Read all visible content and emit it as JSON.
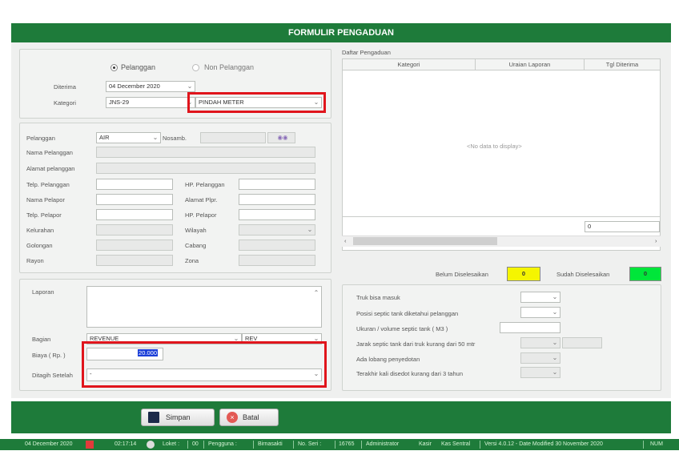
{
  "title": "FORMULIR PENGADUAN",
  "customer_type": {
    "option1": "Pelanggan",
    "option2": "Non Pelanggan",
    "selected": "Pelanggan"
  },
  "form": {
    "diterima_label": "Diterima",
    "diterima_value": "04 December 2020",
    "kategori_label": "Kategori",
    "kategori_code": "JNS-29",
    "kategori_name": "PINDAH METER"
  },
  "pelanggan_section": {
    "pelanggan_label": "Pelanggan",
    "pelanggan_value": "AIR",
    "nosamb_label": "Nosamb.",
    "nama_pelanggan_label": "Nama Pelanggan",
    "alamat_pelanggan_label": "Alamat pelanggan",
    "telp_pelanggan_label": "Telp. Pelanggan",
    "hp_pelanggan_label": "HP. Pelanggan",
    "nama_pelapor_label": "Nama Pelapor",
    "alamat_plpr_label": "Alamat Plpr.",
    "telp_pelapor_label": "Telp. Pelapor",
    "hp_pelapor_label": "HP. Pelapor",
    "kelurahan_label": "Kelurahan",
    "wilayah_label": "Wilayah",
    "golongan_label": "Golongan",
    "cabang_label": "Cabang",
    "rayon_label": "Rayon",
    "zona_label": "Zona"
  },
  "laporan_section": {
    "laporan_label": "Laporan",
    "bagian_label": "Bagian",
    "bagian_value": "REVENUE",
    "bagian_code": "REV",
    "biaya_label": "Biaya ( Rp. )",
    "biaya_value": "20.000",
    "ditagih_label": "Ditagih Setelah",
    "ditagih_value": "-"
  },
  "daftar": {
    "title": "Daftar Pengaduan",
    "columns": [
      "Kategori",
      "Uraian Laporan",
      "Tgl Diterima"
    ],
    "empty_text": "<No data to display>",
    "footer_value": "0"
  },
  "summary": {
    "belum_label": "Belum Diselesaikan",
    "belum_value": "0",
    "belum_color": "#f5f500",
    "sudah_label": "Sudah Diselesaikan",
    "sudah_value": "0",
    "sudah_color": "#00e63a"
  },
  "septic": [
    "Truk bisa masuk",
    "Posisi septic tank diketahui pelanggan",
    "Ukuran / volume septic tank ( M3 )",
    "Jarak septic tank dari truk kurang dari 50 mtr",
    "Ada lobang penyedotan",
    "Terakhir kali disedot kurang dari 3 tahun"
  ],
  "buttons": {
    "save": "Simpan",
    "cancel": "Batal"
  },
  "statusbar": {
    "date": "04 December 2020",
    "time": "02:17:14",
    "loket_label": "Loket :",
    "loket_value": "00",
    "pengguna_label": "Pengguna :",
    "pengguna_value": "Birnasakti",
    "noseri_label": "No. Seri :",
    "noseri_value": "16765",
    "role": "Administrator",
    "kasir_label": "Kasir",
    "kasir_value": "Kas Sentral",
    "version": "Versi 4.0.12 - Date Modified 30 November 2020",
    "num": "NUM"
  },
  "colors": {
    "brand": "#1e7b3a",
    "highlight": "#e0151c",
    "selection": "#1a3ed8"
  }
}
